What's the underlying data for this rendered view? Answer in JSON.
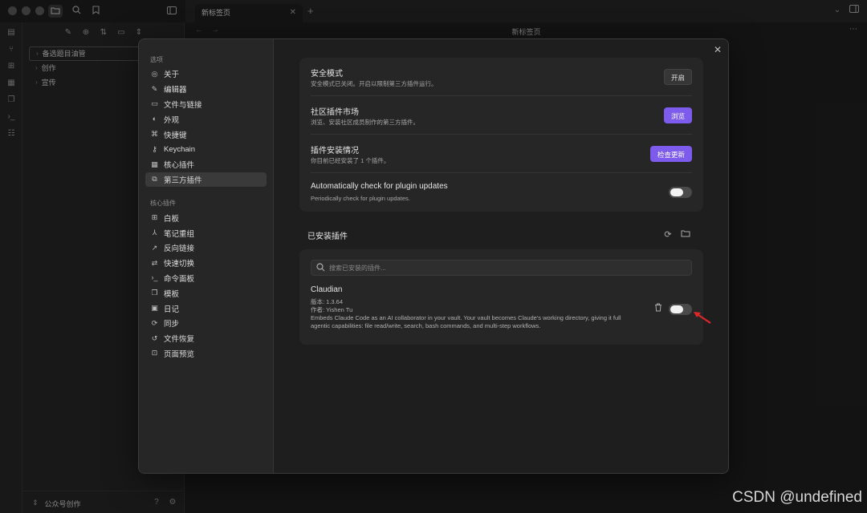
{
  "titlebar": {
    "icons": [
      "folder-icon",
      "search-icon",
      "bookmark-icon",
      "sidebar-toggle-icon"
    ]
  },
  "tabs": [
    {
      "label": "新标签页"
    }
  ],
  "navbar": {
    "title": "新标签页"
  },
  "explorer": {
    "items": [
      {
        "label": "备选题目油管",
        "selected": true
      },
      {
        "label": "创作",
        "selected": false
      },
      {
        "label": "宣传",
        "selected": false
      }
    ],
    "vault_name": "公众号创作"
  },
  "settings_sidebar": {
    "options_header": "选项",
    "options": [
      {
        "label": "关于",
        "icon": "user-circle-icon"
      },
      {
        "label": "编辑器",
        "icon": "pencil-icon"
      },
      {
        "label": "文件与链接",
        "icon": "folder-cog-icon"
      },
      {
        "label": "外观",
        "icon": "palette-icon"
      },
      {
        "label": "快捷键",
        "icon": "command-icon"
      },
      {
        "label": "Keychain",
        "icon": "key-icon"
      },
      {
        "label": "核心插件",
        "icon": "calendar-icon"
      },
      {
        "label": "第三方插件",
        "icon": "puzzle-icon",
        "active": true
      }
    ],
    "core_header": "核心插件",
    "core": [
      {
        "label": "白板",
        "icon": "canvas-icon"
      },
      {
        "label": "笔记重组",
        "icon": "merge-icon"
      },
      {
        "label": "反向链接",
        "icon": "link-icon"
      },
      {
        "label": "快速切换",
        "icon": "switch-icon"
      },
      {
        "label": "命令面板",
        "icon": "terminal-icon"
      },
      {
        "label": "模板",
        "icon": "copy-icon"
      },
      {
        "label": "日记",
        "icon": "calendar-day-icon"
      },
      {
        "label": "同步",
        "icon": "sync-icon"
      },
      {
        "label": "文件恢复",
        "icon": "history-icon"
      },
      {
        "label": "页面预览",
        "icon": "preview-icon"
      }
    ]
  },
  "settings": {
    "safe_mode": {
      "name": "安全模式",
      "desc": "安全模式已关闭。开启以限制第三方插件运行。",
      "button": "开启"
    },
    "market": {
      "name": "社区插件市场",
      "desc": "浏览、安装社区成员制作的第三方插件。",
      "button": "浏览"
    },
    "installs": {
      "name": "插件安装情况",
      "desc": "你目前已经安装了 1 个插件。",
      "button": "检查更新"
    },
    "auto_check": {
      "name": "Automatically check for plugin updates",
      "desc": "Periodically check for plugin updates.",
      "enabled": false
    }
  },
  "installed": {
    "title": "已安装插件",
    "search_placeholder": "搜索已安装的插件...",
    "plugins": [
      {
        "name": "Claudian",
        "version": "版本: 1.3.64",
        "author": "作者: Yishen Tu",
        "desc": "Embeds Claude Code as an AI collaborator in your vault. Your vault becomes Claude's working directory, giving it full agentic capabilities: file read/write, search, bash commands, and multi-step workflows.",
        "enabled": false
      }
    ]
  },
  "watermark": "CSDN @undefined",
  "colors": {
    "accent": "#7d5bed",
    "annotation_arrow": "#e0262a"
  }
}
